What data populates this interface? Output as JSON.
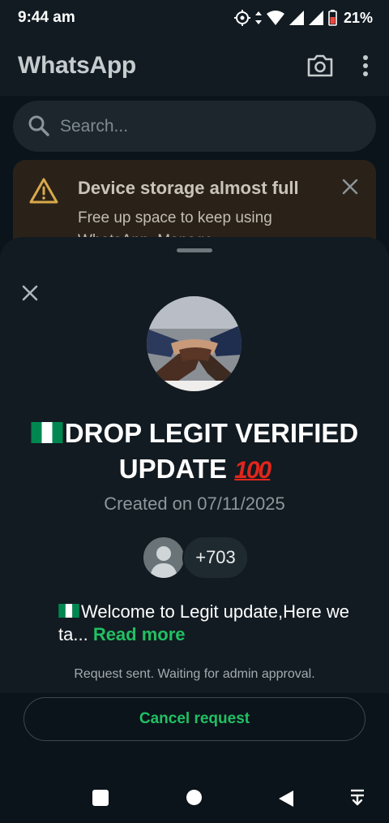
{
  "status_bar": {
    "time": "9:44 am",
    "battery": "21%"
  },
  "header": {
    "title": "WhatsApp"
  },
  "search": {
    "placeholder": "Search..."
  },
  "storage_banner": {
    "title": "Device storage almost full",
    "body": "Free up space to keep using WhatsApp. Manage"
  },
  "group_sheet": {
    "name_part1": "DROP LEGIT VERIFIED",
    "name_part2": "UPDATE",
    "name_emoji": "100",
    "created": "Created on 07/11/2025",
    "member_count": "+703",
    "description": "Welcome to Legit update,Here we ta...",
    "read_more": "Read more",
    "request_status": "Request sent. Waiting for admin approval.",
    "cancel_label": "Cancel request"
  },
  "colors": {
    "accent_green": "#21c063",
    "sheet_bg": "#121b21",
    "banner_bg": "#2a2219",
    "warning_icon": "#d9a94b",
    "flag_green": "#008751",
    "hundred_red": "#e0261c"
  },
  "icons": {
    "camera": "camera-icon",
    "menu": "overflow-menu-icon",
    "search": "search-icon",
    "warning": "warning-icon",
    "close": "close-icon",
    "flag": "nigeria-flag-icon"
  }
}
